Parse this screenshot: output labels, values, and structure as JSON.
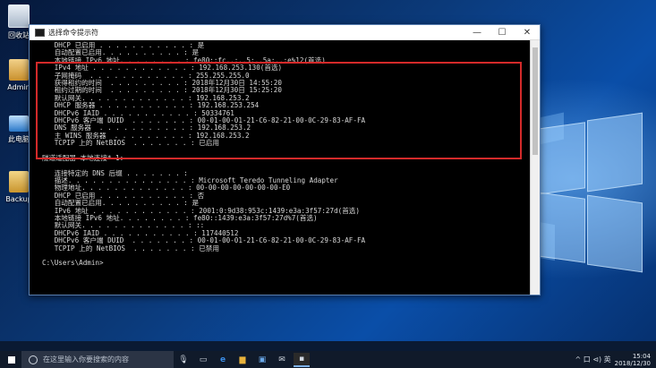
{
  "desktop": {
    "icons": [
      {
        "label": "回收站"
      },
      {
        "label": "Admin"
      },
      {
        "label": "此电脑"
      },
      {
        "label": "Backup"
      }
    ]
  },
  "window": {
    "title": "选择命令提示符",
    "controls": {
      "minimize": "—",
      "maximize": "☐",
      "close": "✕"
    }
  },
  "console": {
    "lines": [
      "   DHCP 已启用 . . . . . . . . . . . : 是",
      "   自动配置已启用. . . . . . . . . . : 是",
      "   本地链接 IPv6 地址. . . . . . . . : fe80::fc..:..5:..5a:..:e%12(首选)",
      "   IPv4 地址 . . . . . . . . . . . . : 192.168.253.130(首选)",
      "   子网掩码  . . . . . . . . . . . . : 255.255.255.0",
      "   获得租约的时间  . . . . . . . . . : 2018年12月30日 14:55:20",
      "   租约过期的时间  . . . . . . . . . : 2018年12月30日 15:25:20",
      "   默认网关. . . . . . . . . . . . . : 192.168.253.2",
      "   DHCP 服务器 . . . . . . . . . . . : 192.168.253.254",
      "   DHCPv6 IAID . . . . . . . . . . . : 50334761",
      "   DHCPv6 客户端 DUID  . . . . . . . : 00-01-00-01-21-C6-82-21-00-0C-29-83-AF-FA",
      "   DNS 服务器  . . . . . . . . . . . : 192.168.253.2",
      "   主 WINS 服务器  . . . . . . . . . : 192.168.253.2",
      "   TCPIP 上的 NetBIOS  . . . . . . . : 已启用",
      "",
      "隧道适配器 本地连接* 1:",
      "",
      "   连接特定的 DNS 后缀 . . . . . . . :",
      "   描述. . . . . . . . . . . . . . . : Microsoft Teredo Tunneling Adapter",
      "   物理地址. . . . . . . . . . . . . : 00-00-00-00-00-00-00-E0",
      "   DHCP 已启用 . . . . . . . . . . . : 否",
      "   自动配置已启用. . . . . . . . . . : 是",
      "   IPv6 地址 . . . . . . . . . . . . : 2001:0:9d38:953c:1439:e3a:3f57:27d(首选)",
      "   本地链接 IPv6 地址. . . . . . . . : fe80::1439:e3a:3f57:27d%7(首选)",
      "   默认网关. . . . . . . . . . . . . : ::",
      "   DHCPv6 IAID . . . . . . . . . . . : 117440512",
      "   DHCPv6 客户端 DUID  . . . . . . . : 00-01-00-01-21-C6-82-21-00-0C-29-83-AF-FA",
      "   TCPIP 上的 NetBIOS  . . . . . . . : 已禁用",
      "",
      "C:\\Users\\Admin>"
    ]
  },
  "taskbar": {
    "search_placeholder": "在这里输入你要搜索的内容",
    "tray_text": "^ 口 ⊲) 英",
    "clock_time": "15:04",
    "clock_date": "2018/12/30"
  }
}
